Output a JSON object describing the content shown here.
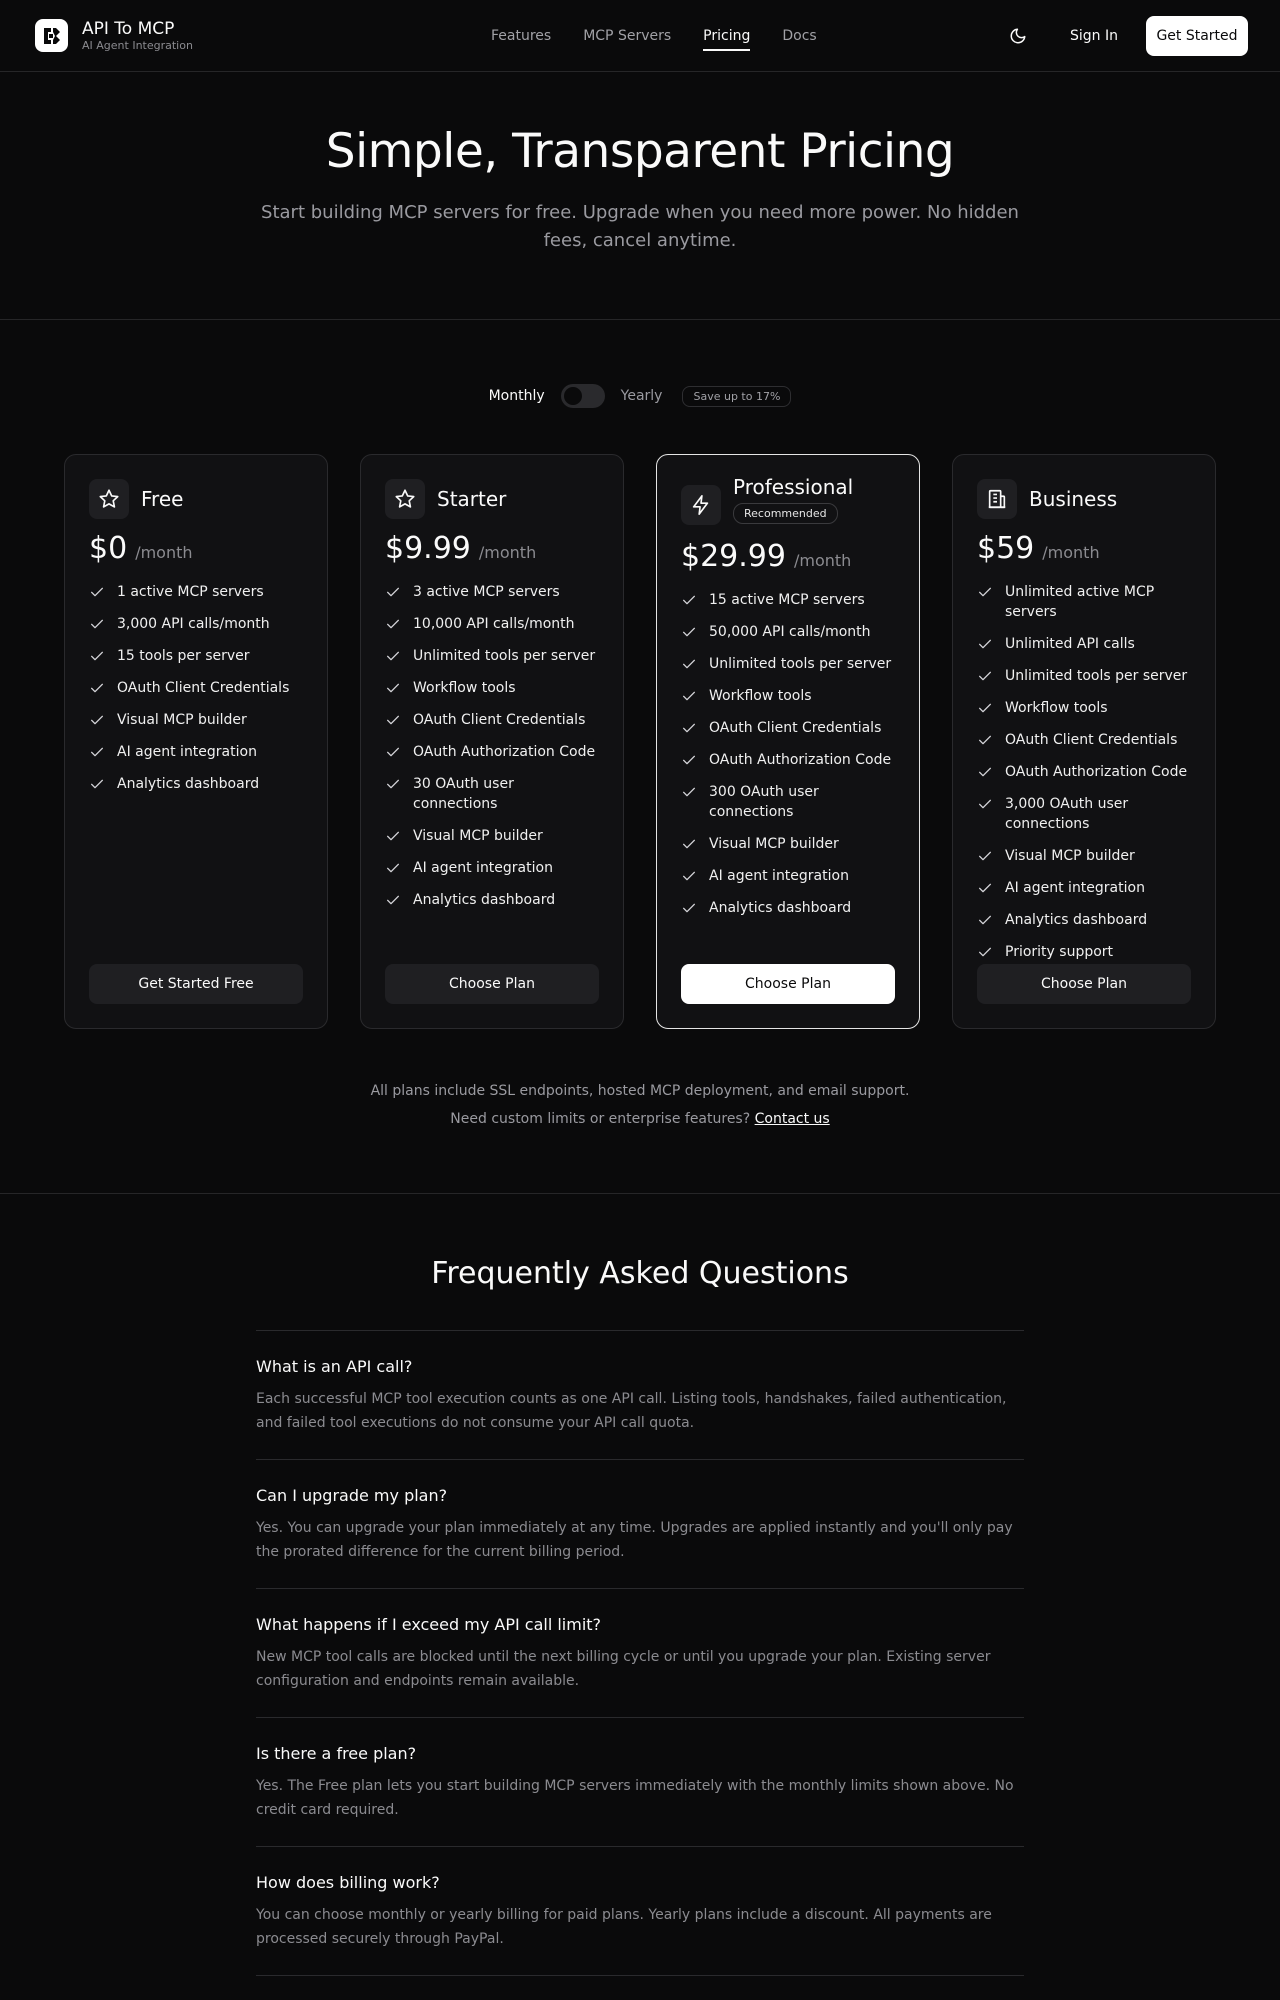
{
  "header": {
    "brand_name": "API To MCP",
    "brand_sub": "AI Agent Integration",
    "nav": [
      "Features",
      "MCP Servers",
      "Pricing",
      "Docs"
    ],
    "active_nav": "Pricing",
    "sign_in": "Sign In",
    "get_started": "Get Started"
  },
  "hero": {
    "title": "Simple, Transparent Pricing",
    "subtitle": "Start building MCP servers for free. Upgrade when you need more power. No hidden fees, cancel anytime."
  },
  "billing": {
    "monthly": "Monthly",
    "yearly": "Yearly",
    "save_badge": "Save up to 17%",
    "yearly_selected": false
  },
  "plans": [
    {
      "name": "Free",
      "icon": "star-icon",
      "price": "$0",
      "per": "/month",
      "button": "Get Started Free",
      "featured": false,
      "features": [
        "1 active MCP servers",
        "3,000 API calls/month",
        "15 tools per server",
        "OAuth Client Credentials",
        "Visual MCP builder",
        "AI agent integration",
        "Analytics dashboard"
      ]
    },
    {
      "name": "Starter",
      "icon": "star-icon",
      "price": "$9.99",
      "per": "/month",
      "button": "Choose Plan",
      "featured": false,
      "features": [
        "3 active MCP servers",
        "10,000 API calls/month",
        "Unlimited tools per server",
        "Workflow tools",
        "OAuth Client Credentials",
        "OAuth Authorization Code",
        "30 OAuth user connections",
        "Visual MCP builder",
        "AI agent integration",
        "Analytics dashboard"
      ]
    },
    {
      "name": "Professional",
      "icon": "lightning-icon",
      "price": "$29.99",
      "per": "/month",
      "badge": "Recommended",
      "button": "Choose Plan",
      "featured": true,
      "features": [
        "15 active MCP servers",
        "50,000 API calls/month",
        "Unlimited tools per server",
        "Workflow tools",
        "OAuth Client Credentials",
        "OAuth Authorization Code",
        "300 OAuth user connections",
        "Visual MCP builder",
        "AI agent integration",
        "Analytics dashboard"
      ]
    },
    {
      "name": "Business",
      "icon": "building-icon",
      "price": "$59",
      "per": "/month",
      "button": "Choose Plan",
      "featured": false,
      "features": [
        "Unlimited active MCP servers",
        "Unlimited API calls",
        "Unlimited tools per server",
        "Workflow tools",
        "OAuth Client Credentials",
        "OAuth Authorization Code",
        "3,000 OAuth user connections",
        "Visual MCP builder",
        "AI agent integration",
        "Analytics dashboard",
        "Priority support"
      ]
    }
  ],
  "notes": {
    "line1": "All plans include SSL endpoints, hosted MCP deployment, and email support.",
    "line2": "Need custom limits or enterprise features?",
    "contact": "Contact us"
  },
  "faq": {
    "title": "Frequently Asked Questions",
    "items": [
      {
        "q": "What is an API call?",
        "a": "Each successful MCP tool execution counts as one API call. Listing tools, handshakes, failed authentication, and failed tool executions do not consume your API call quota."
      },
      {
        "q": "Can I upgrade my plan?",
        "a": "Yes. You can upgrade your plan immediately at any time. Upgrades are applied instantly and you'll only pay the prorated difference for the current billing period."
      },
      {
        "q": "What happens if I exceed my API call limit?",
        "a": "New MCP tool calls are blocked until the next billing cycle or until you upgrade your plan. Existing server configuration and endpoints remain available."
      },
      {
        "q": "Is there a free plan?",
        "a": "Yes. The Free plan lets you start building MCP servers immediately with the monthly limits shown above. No credit card required."
      },
      {
        "q": "How does billing work?",
        "a": "You can choose monthly or yearly billing for paid plans. Yearly plans include a discount. All payments are processed securely through PayPal."
      }
    ]
  }
}
